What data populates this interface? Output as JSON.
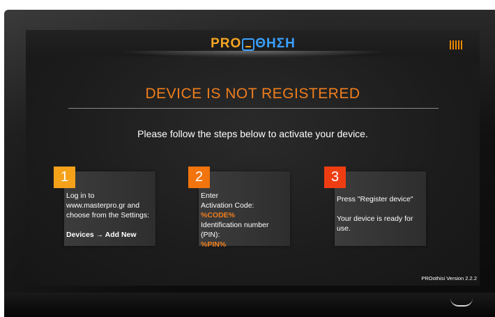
{
  "brand": {
    "part1": "PRO",
    "part2": "ΘΗΣΗ",
    "accent_orange": "#f5a623",
    "accent_blue": "#3aa0ff"
  },
  "status_icon": "signal-bars-icon",
  "title": "DEVICE IS NOT REGISTERED",
  "subtitle": "Please follow the steps below to activate your device.",
  "steps": [
    {
      "number": "1",
      "color": "#f5a11a",
      "line1": "Log in to www.masterpro.gr and choose from the Settings:",
      "line2": "Devices → Add New"
    },
    {
      "number": "2",
      "color": "#f2740c",
      "enter": "Enter",
      "code_label": "Activation Code:",
      "code_value": "%CODE%",
      "pin_label": "Identification number (PIN):",
      "pin_value": "%PIN%"
    },
    {
      "number": "3",
      "color": "#ef3d12",
      "line1": "Press \"Register device\"",
      "line2": "Your device is ready for use."
    }
  ],
  "version": "PROothisi Version 2.2.2"
}
